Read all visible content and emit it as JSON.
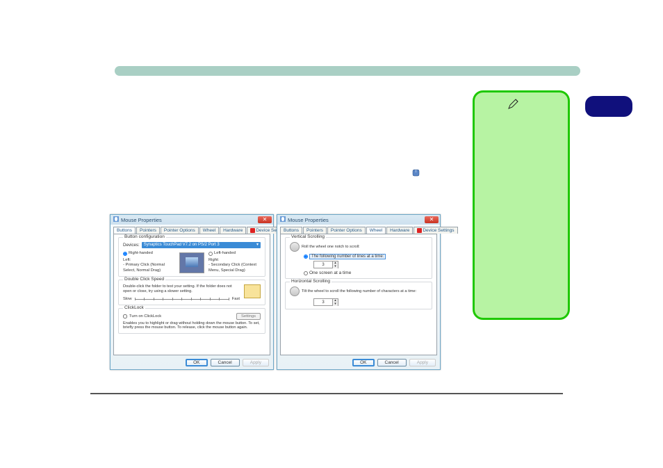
{
  "header": {
    "title_bar": ""
  },
  "note_box": {
    "icon": "pen-icon",
    "content": ""
  },
  "mouse_nav_icon": "mouse-icon",
  "dialog_left": {
    "title": "Mouse Properties",
    "tabs": [
      "Buttons",
      "Pointers",
      "Pointer Options",
      "Wheel",
      "Hardware",
      "Device Settings"
    ],
    "active_tab": 0,
    "device_settings_has_icon": true,
    "buttons": {
      "group_config": {
        "legend": "Button configuration",
        "devices_label": "Devices:",
        "devices_value": "Synaptics TouchPad V7.2 on PS/2 Port 3",
        "right_handed": "Right-handed",
        "left_handed": "Left-handed",
        "right_handed_selected": true,
        "left_title": "Left:",
        "left_desc": "- Primary Click (Normal Select, Normal Drag)",
        "right_title": "Right:",
        "right_desc": "- Secondary Click (Context Menu, Special Drag)"
      },
      "group_dcs": {
        "legend": "Double Click Speed",
        "desc": "Double-click the folder to test your setting. If the folder does not open or close, try using a slower setting.",
        "slow": "Slow",
        "fast": "Fast"
      },
      "group_clicklock": {
        "legend": "ClickLock",
        "turnon": "Turn on ClickLock",
        "settings_btn": "Settings",
        "desc": "Enables you to highlight or drag without holding down the mouse button. To set, briefly press the mouse button. To release, click the mouse button again."
      }
    },
    "footer": {
      "ok": "OK",
      "cancel": "Cancel",
      "apply": "Apply"
    }
  },
  "dialog_right": {
    "title": "Mouse Properties",
    "tabs": [
      "Buttons",
      "Pointers",
      "Pointer Options",
      "Wheel",
      "Hardware",
      "Device Settings"
    ],
    "active_tab": 3,
    "device_settings_has_icon": true,
    "wheel": {
      "vert": {
        "legend": "Vertical Scrolling",
        "desc": "Roll the wheel one notch to scroll:",
        "opt1": "The following number of lines at a time:",
        "opt1_selected": true,
        "value": "3",
        "opt2": "One screen at a time"
      },
      "horz": {
        "legend": "Horizontal Scrolling",
        "desc": "Tilt the wheel to scroll the following number of characters at a time:",
        "value": "3"
      }
    },
    "footer": {
      "ok": "OK",
      "cancel": "Cancel",
      "apply": "Apply"
    }
  }
}
